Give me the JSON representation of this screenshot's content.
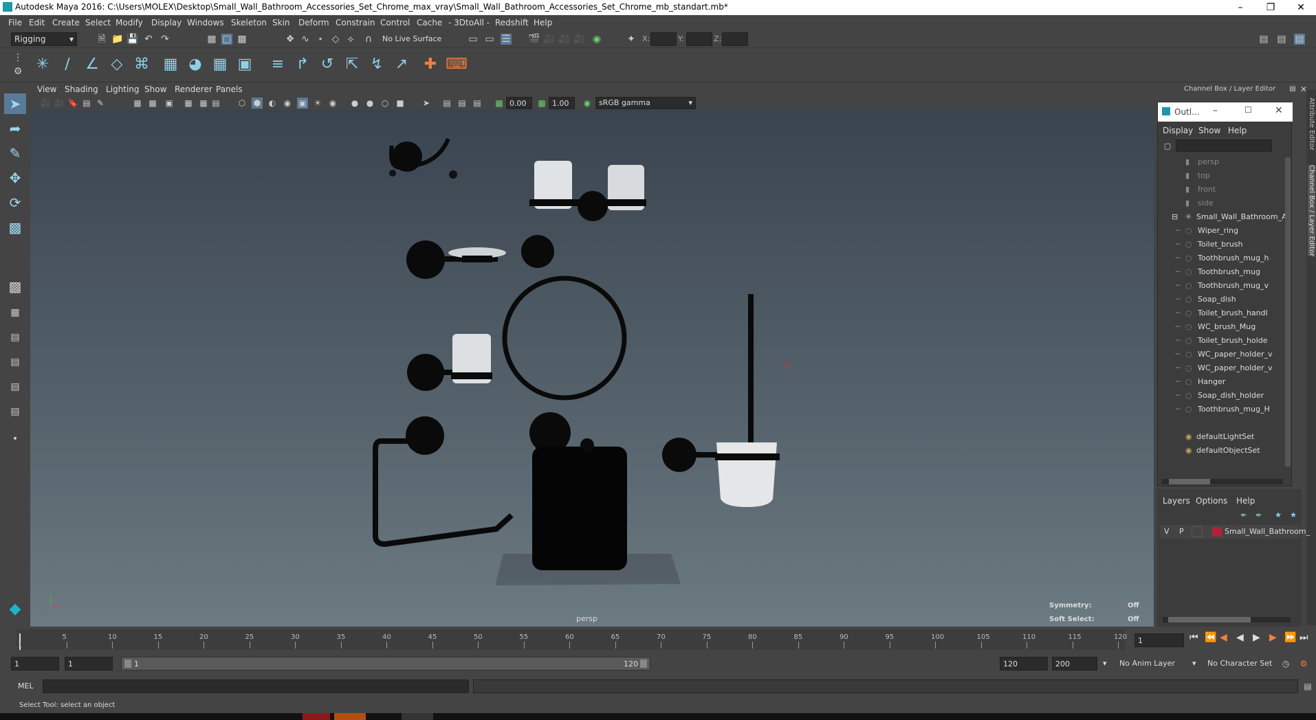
{
  "window": {
    "title": "Autodesk Maya 2016: C:\\Users\\MOLEX\\Desktop\\Small_Wall_Bathroom_Accessories_Set_Chrome_max_vray\\Small_Wall_Bathroom_Accessories_Set_Chrome_mb_standart.mb*"
  },
  "menubar": [
    "File",
    "Edit",
    "Create",
    "Select",
    "Modify",
    "Display",
    "Windows",
    "Skeleton",
    "Skin",
    "Deform",
    "Constrain",
    "Control",
    "Cache",
    "- 3DtoAll -",
    "Redshift",
    "Help"
  ],
  "statusline": {
    "menuset": "Rigging",
    "live_surface": "No Live Surface",
    "x_label": "X:",
    "y_label": "Y:",
    "z_label": "Z:"
  },
  "viewport": {
    "menus": [
      "View",
      "Shading",
      "Lighting",
      "Show",
      "Renderer",
      "Panels"
    ],
    "exposure": "0.00",
    "gamma": "1.00",
    "colorspace": "sRGB gamma",
    "camera_label": "persp",
    "symmetry_label": "Symmetry:",
    "symmetry_value": "Off",
    "softselect_label": "Soft Select:",
    "softselect_value": "Off"
  },
  "right_panel": {
    "header": "Channel Box / Layer Editor",
    "side_tabs": [
      "Attribute Editor",
      "Channel Box / Layer Editor"
    ]
  },
  "outliner": {
    "title": "Outl...",
    "menus": [
      "Display",
      "Show",
      "Help"
    ],
    "cameras": [
      "persp",
      "top",
      "front",
      "side"
    ],
    "group": "Small_Wall_Bathroom_A",
    "children": [
      "Wiper_ring",
      "Toilet_brush",
      "Toothbrush_mug_h",
      "Toothbrush_mug",
      "Toothbrush_mug_v",
      "Soap_dish",
      "Toilet_brush_handl",
      "WC_brush_Mug",
      "Toilet_brush_holde",
      "WC_paper_holder_v",
      "WC_paper_holder_v",
      "Hanger",
      "Soap_dish_holder",
      "Toothbrush_mug_H"
    ],
    "sets": [
      "defaultLightSet",
      "defaultObjectSet"
    ]
  },
  "layers": {
    "menus": [
      "Layers",
      "Options",
      "Help"
    ],
    "row": {
      "v": "V",
      "p": "P",
      "name": "Small_Wall_Bathroom_",
      "color": "#b0223a"
    }
  },
  "timeline": {
    "ticks": [
      "5",
      "10",
      "15",
      "20",
      "25",
      "30",
      "35",
      "40",
      "45",
      "50",
      "55",
      "60",
      "65",
      "70",
      "75",
      "80",
      "85",
      "90",
      "95",
      "100",
      "105",
      "110",
      "115",
      "120"
    ],
    "start_marker": "1",
    "current_frame": "1"
  },
  "range": {
    "start": "1",
    "playback_start": "1",
    "slider_start": "1",
    "slider_end": "120",
    "playback_end": "120",
    "end": "200",
    "anim_layer": "No Anim Layer",
    "character_set": "No Character Set"
  },
  "cmdline": {
    "label": "MEL"
  },
  "helpline": {
    "text": "Select Tool: select an object"
  },
  "icons": [
    "select-tool-icon",
    "lasso-icon",
    "paint-icon",
    "move-icon",
    "rotate-icon",
    "scale-icon"
  ]
}
